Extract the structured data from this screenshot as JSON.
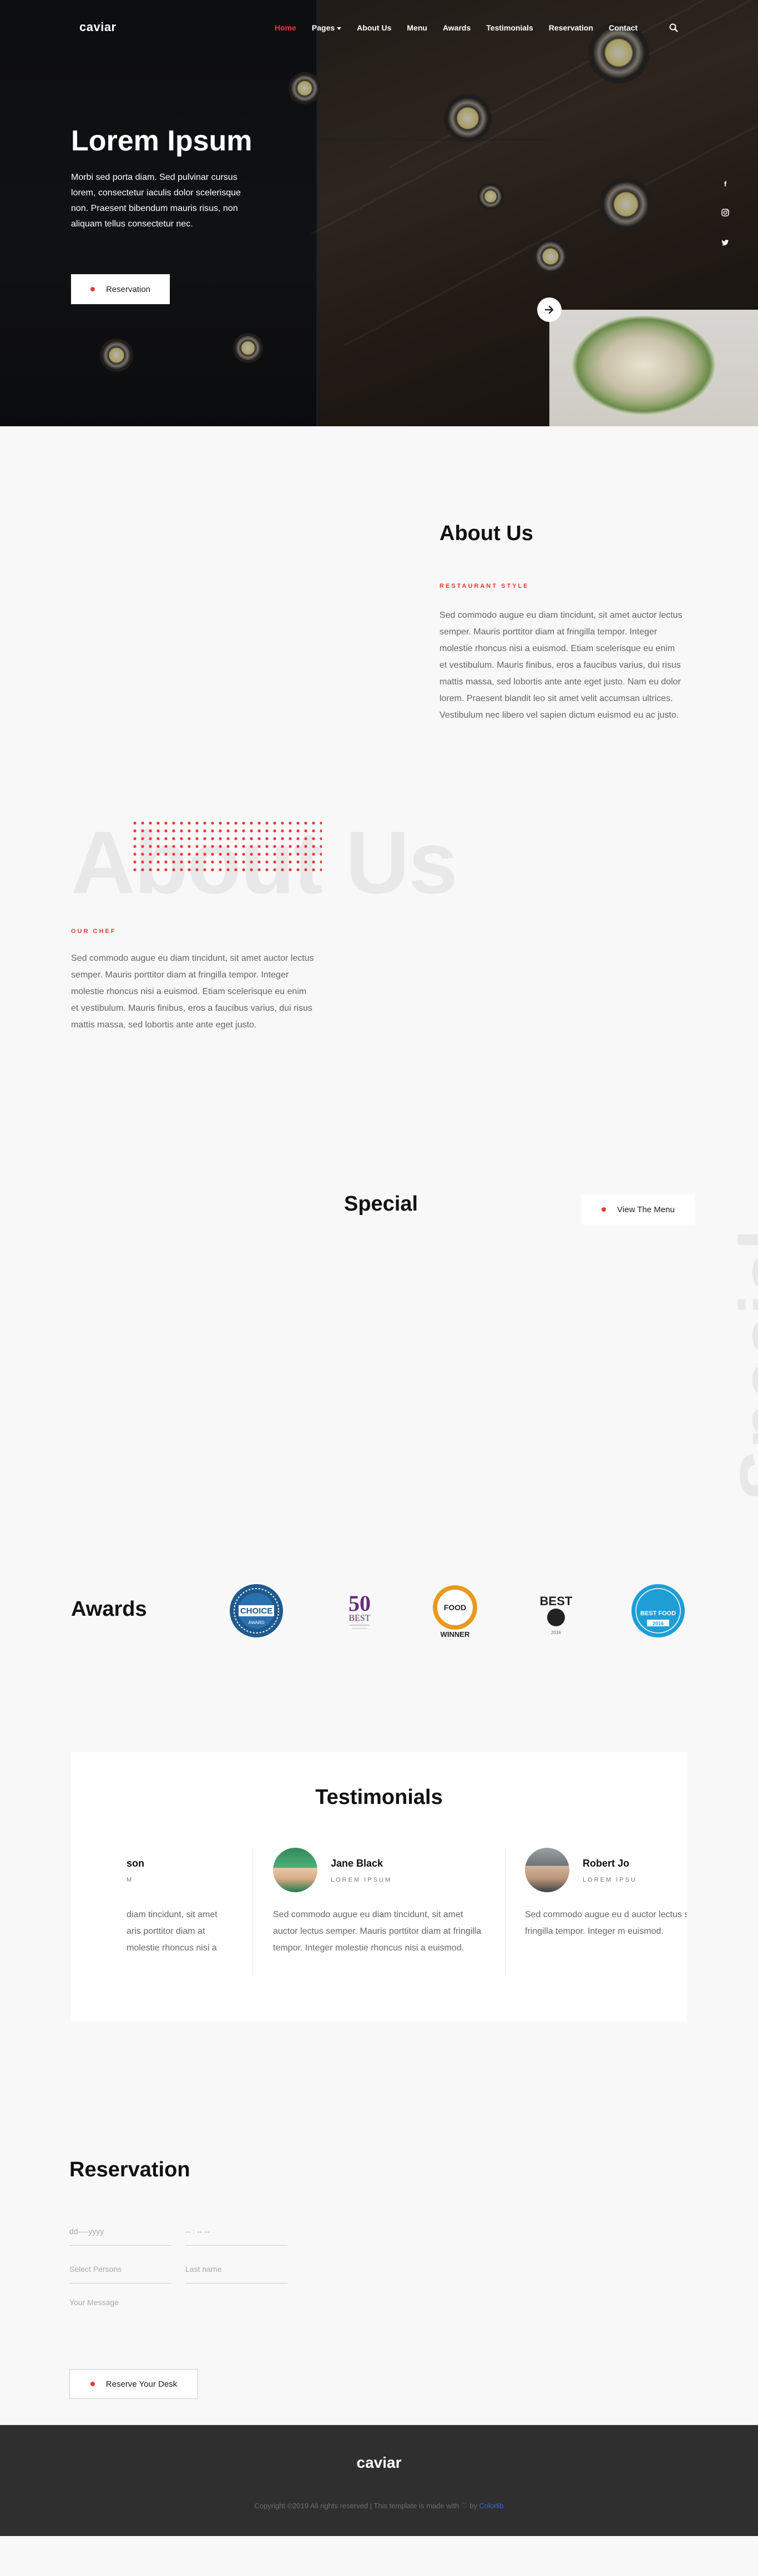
{
  "header": {
    "logo": "caviar",
    "menu": [
      {
        "label": "Home",
        "active": true
      },
      {
        "label": "Pages",
        "has_dropdown": true
      },
      {
        "label": "About Us"
      },
      {
        "label": "Menu"
      },
      {
        "label": "Awards"
      },
      {
        "label": "Testimonials"
      },
      {
        "label": "Reservation"
      },
      {
        "label": "Contact"
      }
    ],
    "search_icon": "search-icon"
  },
  "hero": {
    "title": "Lorem Ipsum",
    "text": "Morbi sed porta diam. Sed pulvinar cursus lorem, consectetur iaculis dolor scelerisque non. Praesent bibendum mauris risus, non aliquam tellus consectetur nec.",
    "button": "Reservation",
    "social": [
      "f",
      "instagram-icon",
      "twitter-icon"
    ]
  },
  "about": {
    "title": "About Us",
    "eyebrow": "RESTAURANT STYLE",
    "text": "Sed commodo augue eu diam tincidunt, sit amet auctor lectus semper. Mauris porttitor diam at fringilla tempor. Integer molestie rhoncus nisi a euismod. Etiam scelerisque eu enim et vestibulum. Mauris finibus, eros a faucibus varius, dui risus mattis massa, sed lobortis ante ante eget justo. Nam eu dolor lorem. Praesent blandit leo sit amet velit accumsan ultrices. Vestibulum nec libero vel sapien dictum euismod eu ac justo.",
    "watermark": "About Us"
  },
  "chef": {
    "eyebrow": "OUR CHEF",
    "text": "Sed commodo augue eu diam tincidunt, sit amet auctor lectus semper. Mauris porttitor diam at fringilla tempor. Integer molestie rhoncus nisi a euismod. Etiam scelerisque eu enim et vestibulum. Mauris finibus, eros a faucibus varius, dui risus mattis massa, sed lobortis ante ante eget justo."
  },
  "special": {
    "title": "Special",
    "button": "View The Menu",
    "watermark": "Special"
  },
  "awards": {
    "title": "Awards",
    "badges": [
      {
        "line1": "CHOICE",
        "line2": "AWARD",
        "color": "#1f5a8f"
      },
      {
        "line1": "50",
        "line2": "BEST",
        "color": "#6b2a7a"
      },
      {
        "line1": "FOOD",
        "line2": "WINNER",
        "color": "#e89a1e"
      },
      {
        "line1": "BEST",
        "line2": "2016",
        "color": "#222222"
      },
      {
        "line1": "BEST FOOD",
        "line2": "2016",
        "color": "#1f9ed6"
      }
    ]
  },
  "testimonials": {
    "title": "Testimonials",
    "items": [
      {
        "name": "son",
        "role": "M",
        "text": "diam tincidunt, sit amet aris porttitor diam at molestie rhoncus nisi a"
      },
      {
        "name": "Jane Black",
        "role": "LOREM IPSUM",
        "text": "Sed commodo augue eu diam tincidunt, sit amet auctor lectus semper. Mauris porttitor diam at fringilla tempor. Integer molestie rhoncus nisi a euismod."
      },
      {
        "name": "Robert Jo",
        "role": "LOREM IPSU",
        "text": "Sed commodo augue eu d auctor lectus semper. Ma fringilla tempor. Integer m euismod."
      }
    ]
  },
  "reservation": {
    "title": "Reservation",
    "date_placeholder": "dd----yyyy",
    "time_placeholder": "-- : -- --",
    "persons_placeholder": "Select Persons",
    "lastname_placeholder": "Last name",
    "message_placeholder": "Your Message",
    "button": "Reserve Your Desk"
  },
  "footer": {
    "logo": "caviar",
    "copyright": "Copyright ©2019 All rights reserved | This template is made with ♡ by",
    "brand": "Colorlib"
  }
}
